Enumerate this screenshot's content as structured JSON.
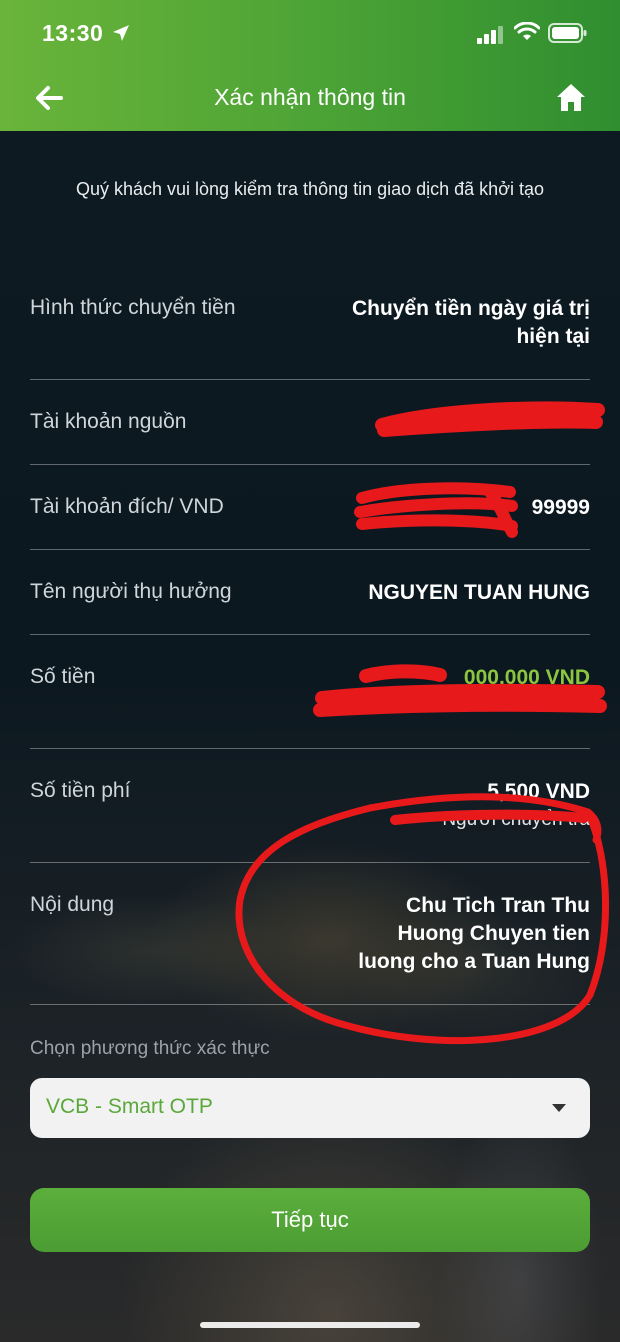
{
  "status_bar": {
    "time": "13:30",
    "icons": [
      "location-arrow-icon",
      "signal-icon",
      "wifi-icon",
      "battery-icon"
    ]
  },
  "header": {
    "title": "Xác nhận thông tin",
    "back_icon": "back-arrow-icon",
    "home_icon": "home-icon",
    "colors": {
      "gradient_start": "#6ab43a",
      "gradient_end": "#2f8e2f"
    }
  },
  "intro": "Quý khách vui lòng kiểm tra thông tin giao dịch đã khởi tạo",
  "details": [
    {
      "label": "Hình thức chuyển tiền",
      "value_line1": "Chuyển tiền ngày giá trị",
      "value_line2": "hiện tại"
    },
    {
      "label": "Tài khoản nguồn",
      "value": ""
    },
    {
      "label": "Tài khoản đích/ VND",
      "value": "99999"
    },
    {
      "label": "Tên người thụ hưởng",
      "value": "NGUYEN TUAN HUNG"
    },
    {
      "label": "Số tiền",
      "value": "000,000 VND"
    },
    {
      "label": "Số tiền phí",
      "value": "5,500 VND",
      "sub_value": "Người chuyển trả"
    },
    {
      "label": "Nội dung",
      "value_line1": "Chu Tich Tran Thu",
      "value_line2": "Huong Chuyen tien",
      "value_line3": "luong cho a Tuan Hung"
    }
  ],
  "auth": {
    "label": "Chọn phương thức xác thực",
    "selected": "VCB - Smart OTP"
  },
  "continue_label": "Tiếp tục",
  "colors": {
    "amount_green": "#8cc63f",
    "button_green": "#4b9d33",
    "annotation_red": "#e8191b"
  }
}
